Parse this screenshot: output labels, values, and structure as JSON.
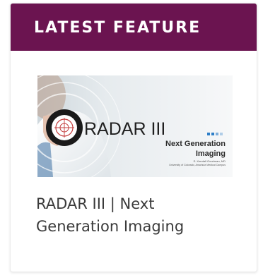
{
  "header": {
    "title": "LATEST FEATURE"
  },
  "feature": {
    "image": {
      "name": "RADAR III",
      "subtitle_line1": "Next Generation",
      "subtitle_line2": "Imaging",
      "credit_line1": "E. Kendall Goodman, MD",
      "credit_line2": "University of Colorado, Anschutz Medical Campus"
    },
    "title_line1": "RADAR III | Next",
    "title_line2": "Generation Imaging"
  },
  "colors": {
    "header_bg": "#6b1450",
    "accent_blue": "#2f7fc8"
  }
}
